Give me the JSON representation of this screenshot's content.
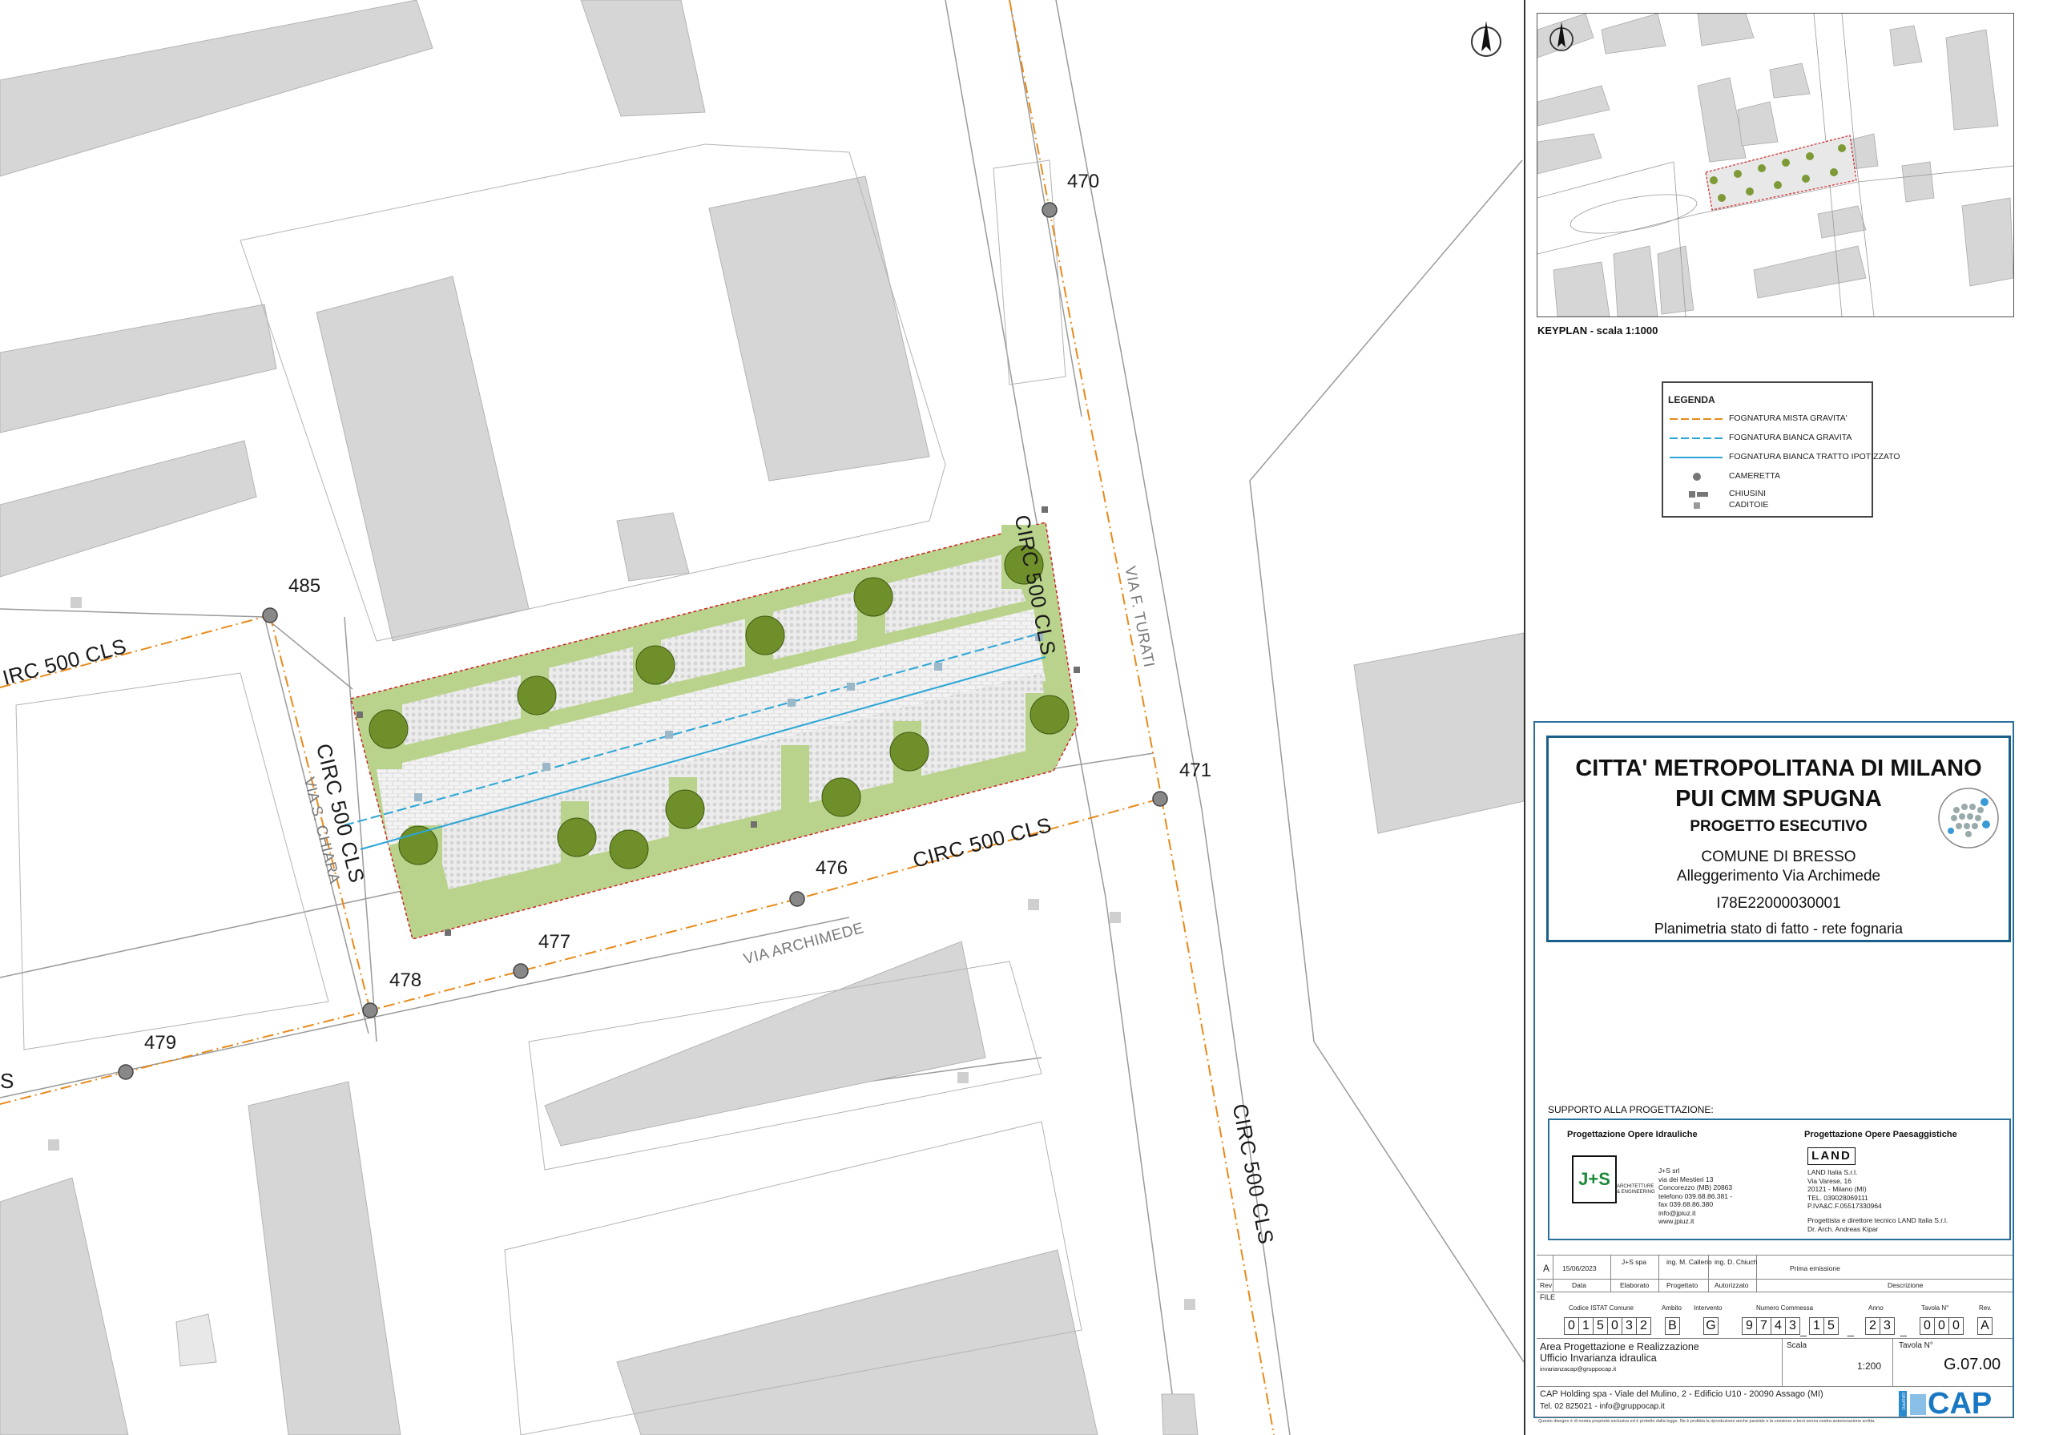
{
  "map": {
    "manholes": [
      {
        "label": "470"
      },
      {
        "label": "471"
      },
      {
        "label": "476"
      },
      {
        "label": "477"
      },
      {
        "label": "478"
      },
      {
        "label": "479"
      },
      {
        "label": "485"
      }
    ],
    "pipe_labels": [
      "CIRC 500 CLS",
      "CIRC 500 CLS",
      "CIRC 500 CLS",
      "CIRC 500 CLS",
      "IRC 500 CLS"
    ],
    "streets": [
      "VIA F. TURATI",
      "VIA S. CHIARA",
      "VIA ARCHIMEDE"
    ],
    "edge_fragment": "S"
  },
  "keyplan": {
    "label": "KEYPLAN - scala 1:1000"
  },
  "legend": {
    "title": "LEGENDA",
    "items": [
      {
        "label": "FOGNATURA MISTA GRAVITA'",
        "color": "#e88a1a"
      },
      {
        "label": "FOGNATURA BIANCA GRAVITA",
        "color": "#2aa6d6"
      },
      {
        "label": "FOGNATURA BIANCA TRATTO IPOTIZZATO",
        "color": "#2aa6d6"
      },
      {
        "label": "CAMERETTA",
        "color": "#777777"
      },
      {
        "label": "CHIUSINI",
        "color": "#777777"
      },
      {
        "label": "CADITOIE",
        "color": "#777777"
      }
    ]
  },
  "title_block": {
    "line1": "CITTA' METROPOLITANA DI MILANO",
    "line2": "PUI CMM SPUGNA",
    "line3": "PROGETTO ESECUTIVO",
    "line4": "COMUNE DI BRESSO",
    "line5": "Alleggerimento Via Archimede",
    "line6": "I78E22000030001",
    "line7": "Planimetria stato di fatto - rete fognaria"
  },
  "support": {
    "label": "SUPPORTO ALLA PROGETTAZIONE:",
    "left_heading": "Progettazione Opere Idrauliche",
    "right_heading": "Progettazione Opere Paesaggistiche",
    "js_logo": "J+S",
    "js_caption": "ARCHITETTURE & ENGINEERING",
    "js_address": [
      "J+S  srl",
      "via dei Mestieri 13",
      "Concorezzo (MB) 20863",
      "telefono  039.68.86.381 -",
      "fax  039.68.86.380",
      "info@jpiuz.it",
      "www.jpiuz.it"
    ],
    "land_logo": "LAND",
    "land_address": [
      "LAND Italia S.r.l.",
      "Via Varese, 16",
      "20121 - Milano (MI)",
      "TEL. 039028069111",
      "P.IVA&C.F.05517330964"
    ],
    "land_director": [
      "Progettista e direttore tecnico LAND Italia S.r.l.",
      "Dr. Arch. Andreas Kipar"
    ]
  },
  "revision": {
    "rev": "A",
    "date": "15/06/2023",
    "drawn": "J+S spa",
    "designed": "ing. M. Callerio",
    "authorized": "ing. D. Chiuch",
    "description": "Prima emissione",
    "headers": [
      "Rev",
      "Data",
      "Elaborato",
      "Progettato",
      "Autorizzato",
      "Descrizione"
    ]
  },
  "file_codes": {
    "file_label": "FILE",
    "istat_label": "Codice ISTAT Comune",
    "istat": [
      "0",
      "1",
      "5",
      "0",
      "3",
      "2"
    ],
    "ambito_label": "Ambito",
    "ambito": "B",
    "intervento_label": "Intervento",
    "intervento": "G",
    "commessa_label": "Numero Commessa",
    "commessa": [
      "9",
      "7",
      "4",
      "3"
    ],
    "commessa2": [
      "1",
      "5"
    ],
    "anno_label": "Anno",
    "anno": [
      "2",
      "3"
    ],
    "tavola_label": "Tavola N°",
    "tavola": [
      "0",
      "0",
      "0"
    ],
    "rev_label": "Rev.",
    "rev": "A"
  },
  "footer": {
    "area1": "Area Progettazione e Realizzazione",
    "area2": "Ufficio Invarianza idraulica",
    "email": "invarianzacap@gruppocap.it",
    "scala_label": "Scala",
    "scala": "1:200",
    "tavola_label": "Tavola N°",
    "tavola": "G.07.00",
    "company": "CAP Holding spa - Viale del Mulino, 2 - Edificio U10 - 20090 Assago (MI)",
    "contact": "Tel. 02 825021 - info@gruppocap.it",
    "logo": "CAP",
    "logo_small": "GRUPPO",
    "disclaimer": "Questo disegno è di nostra proprietà esclusiva ed è protetto dalla legge. Ne è proibita la riproduzione anche parziale e la cessione a terzi senza nostra autorizzazione scritta."
  },
  "colors": {
    "mista": "#e88a1a",
    "bianca": "#2aa6d6",
    "building": "#d8d8d8",
    "green": "#b8d08a",
    "frame": "#1a5f8a"
  }
}
